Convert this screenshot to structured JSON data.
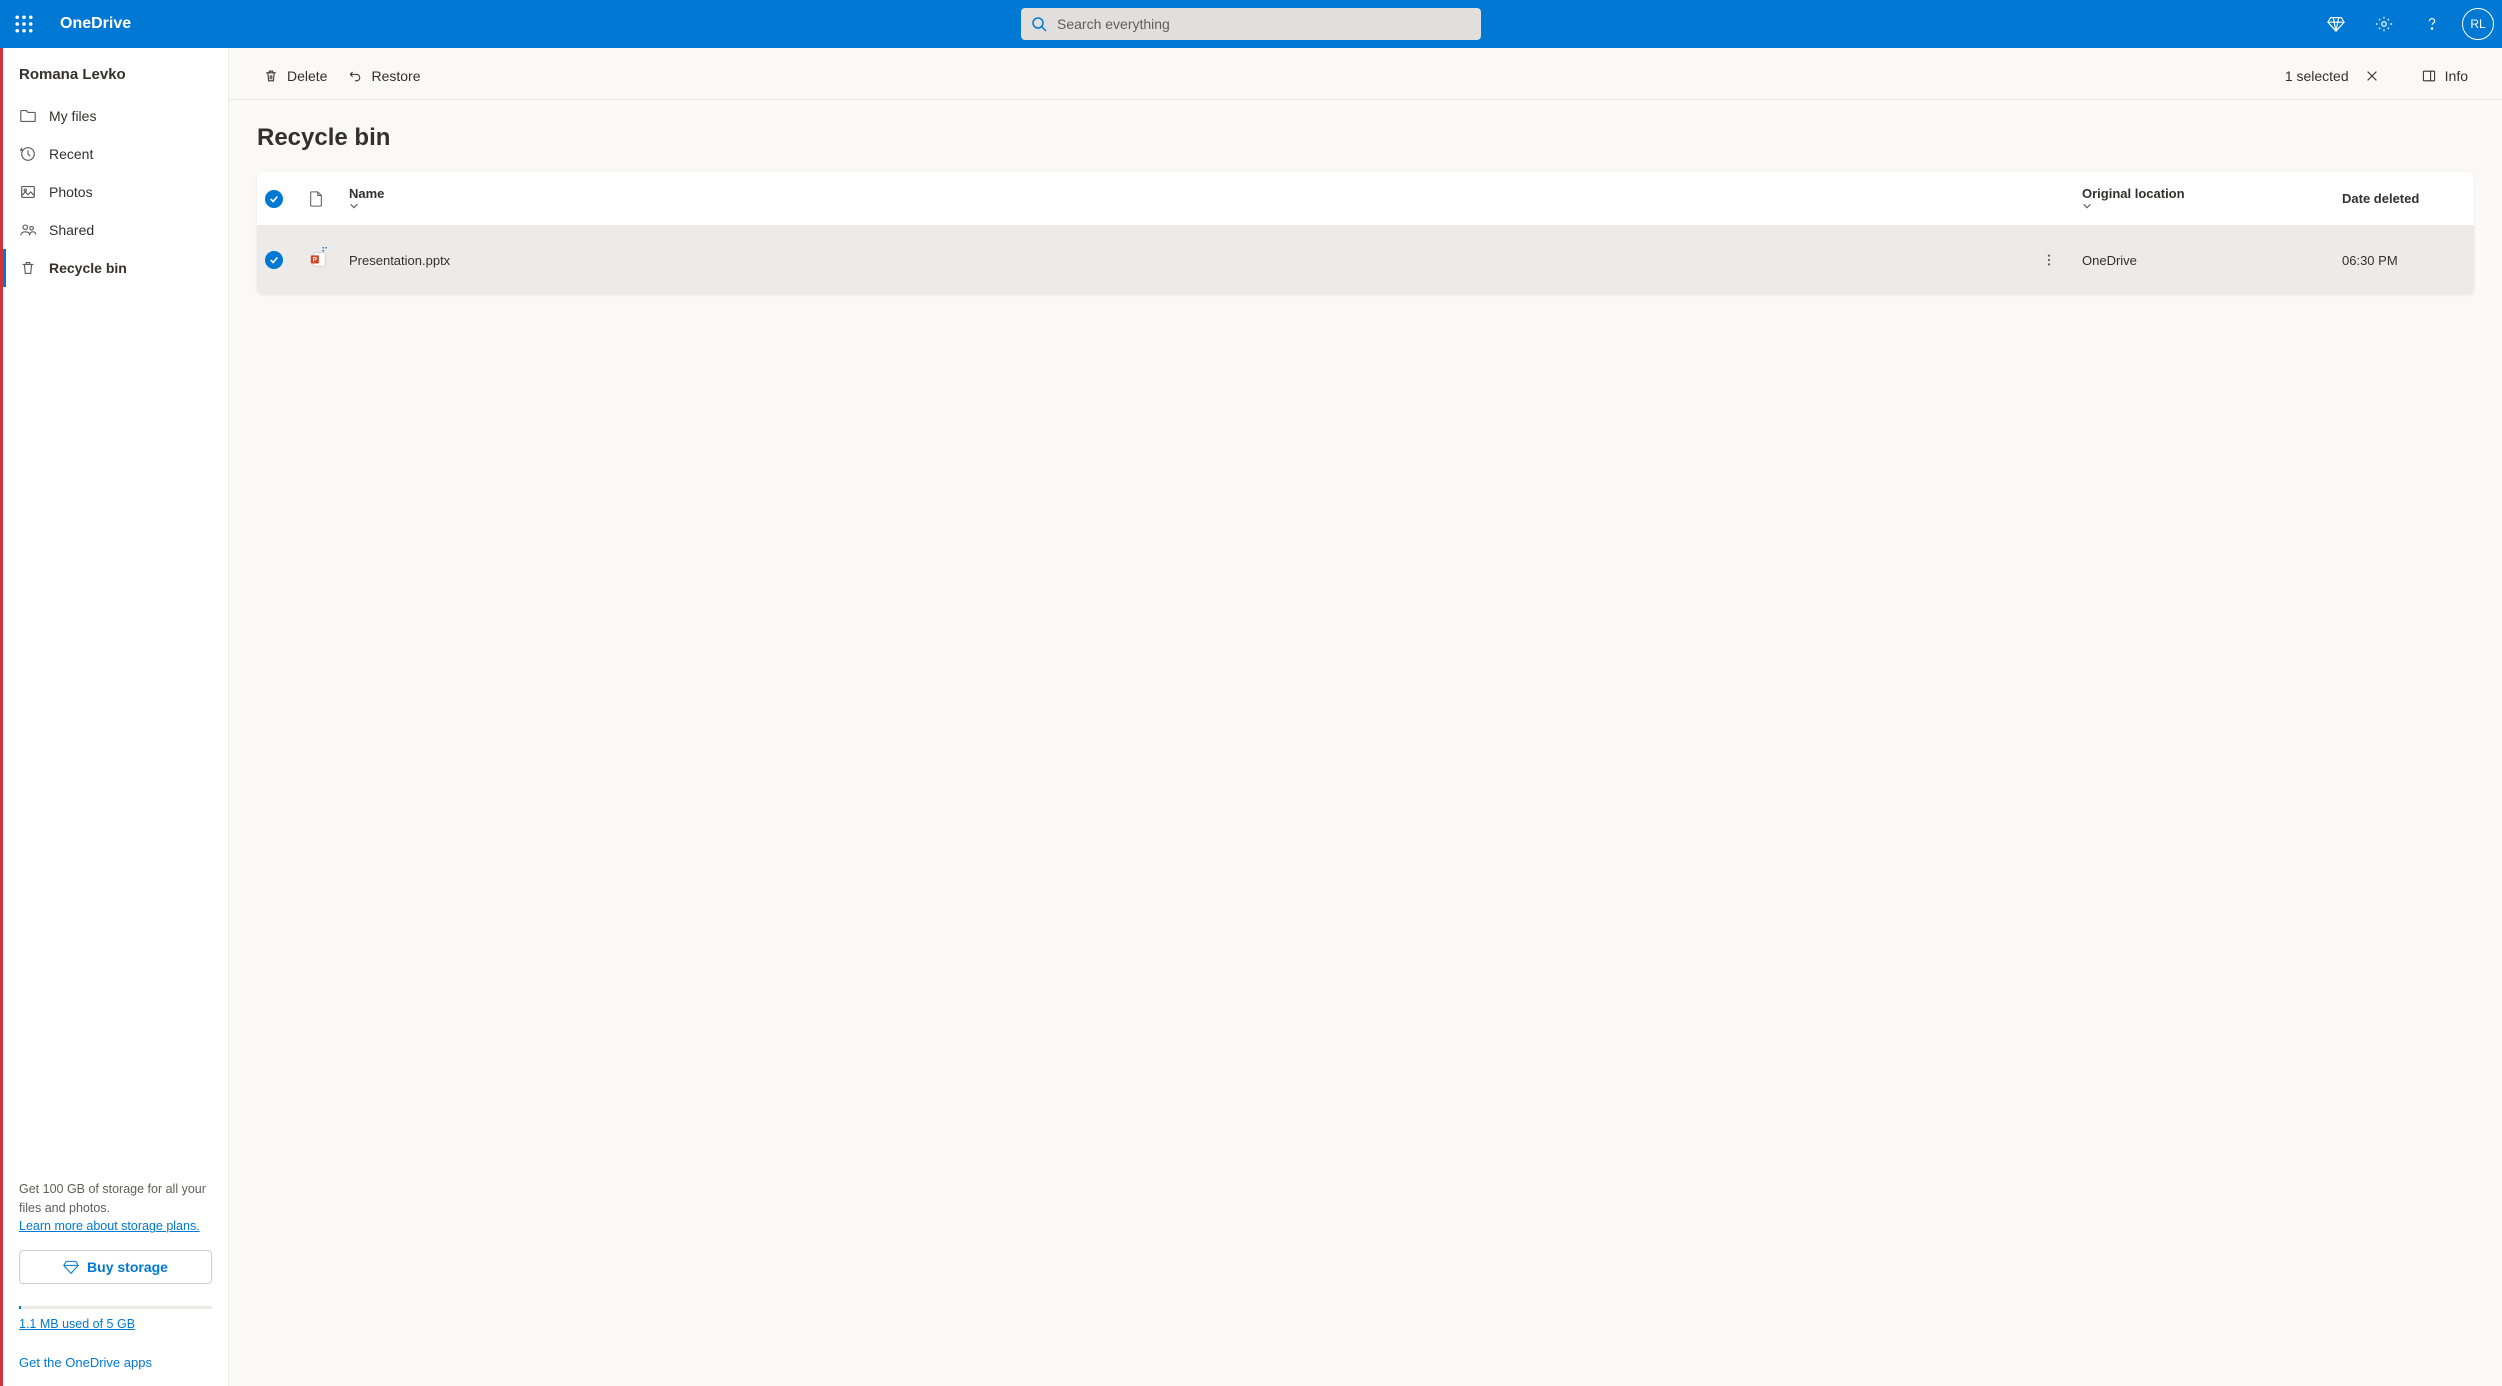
{
  "header": {
    "brand": "OneDrive",
    "search_placeholder": "Search everything",
    "avatar_initials": "RL"
  },
  "sidebar": {
    "user_name": "Romana Levko",
    "items": [
      {
        "label": "My files"
      },
      {
        "label": "Recent"
      },
      {
        "label": "Photos"
      },
      {
        "label": "Shared"
      },
      {
        "label": "Recycle bin"
      }
    ],
    "promo_text": "Get 100 GB of storage for all your files and photos.",
    "promo_link": "Learn more about storage plans.",
    "buy_label": "Buy storage",
    "storage_used": "1.1 MB used of 5 GB",
    "get_apps": "Get the OneDrive apps"
  },
  "toolbar": {
    "delete_label": "Delete",
    "restore_label": "Restore",
    "selected_text": "1 selected",
    "info_label": "Info"
  },
  "page": {
    "title": "Recycle bin"
  },
  "table": {
    "columns": {
      "name": "Name",
      "location": "Original location",
      "date": "Date deleted"
    },
    "rows": [
      {
        "name": "Presentation.pptx",
        "location": "OneDrive",
        "date": "06:30 PM"
      }
    ]
  }
}
